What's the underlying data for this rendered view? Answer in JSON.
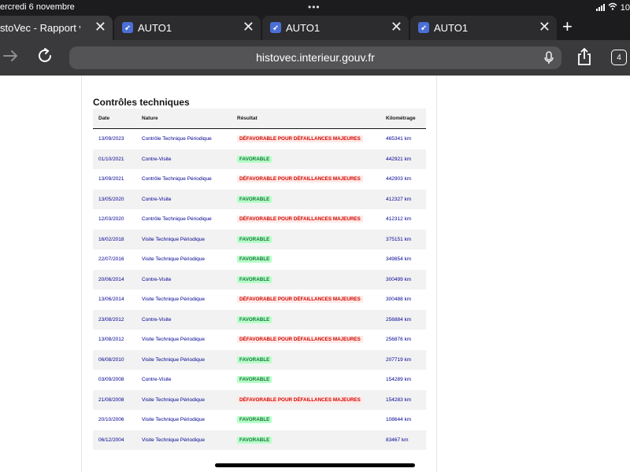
{
  "status": {
    "date": "ercredi 6 novembre",
    "dots": "•••",
    "time": "10"
  },
  "tabs": [
    {
      "label": "stoVec - Rapport vende",
      "active": true
    },
    {
      "label": "AUTO1",
      "active": false
    },
    {
      "label": "AUTO1",
      "active": false
    },
    {
      "label": "AUTO1",
      "active": false
    }
  ],
  "toolbar": {
    "url": "histovec.interieur.gouv.fr",
    "tab_count": "4"
  },
  "section": {
    "title": "Contrôles techniques"
  },
  "table": {
    "headers": [
      "Date",
      "Nature",
      "Résultat",
      "Kilométrage"
    ],
    "rows": [
      {
        "date": "13/09/2023",
        "nature": "Contrôle Technique Périodique",
        "result": "DÉFAVORABLE POUR DÉFAILLANCES MAJEURES",
        "km": "465341 km"
      },
      {
        "date": "01/10/2021",
        "nature": "Contre-Visite",
        "result": "FAVORABLE",
        "km": "442921 km"
      },
      {
        "date": "13/09/2021",
        "nature": "Contrôle Technique Périodique",
        "result": "DÉFAVORABLE POUR DÉFAILLANCES MAJEURES",
        "km": "442903 km"
      },
      {
        "date": "13/05/2020",
        "nature": "Contre-Visite",
        "result": "FAVORABLE",
        "km": "412327 km"
      },
      {
        "date": "12/03/2020",
        "nature": "Contrôle Technique Périodique",
        "result": "DÉFAVORABLE POUR DÉFAILLANCES MAJEURES",
        "km": "412312 km"
      },
      {
        "date": "16/02/2018",
        "nature": "Visite Technique Périodique",
        "result": "FAVORABLE",
        "km": "375151 km"
      },
      {
        "date": "22/07/2016",
        "nature": "Visite Technique Périodique",
        "result": "FAVORABLE",
        "km": "349854 km"
      },
      {
        "date": "20/06/2014",
        "nature": "Contre-Visite",
        "result": "FAVORABLE",
        "km": "300499 km"
      },
      {
        "date": "13/06/2014",
        "nature": "Visite Technique Périodique",
        "result": "DÉFAVORABLE POUR DÉFAILLANCES MAJEURES",
        "km": "300488 km"
      },
      {
        "date": "23/08/2012",
        "nature": "Contre-Visite",
        "result": "FAVORABLE",
        "km": "256884 km"
      },
      {
        "date": "13/08/2012",
        "nature": "Visite Technique Périodique",
        "result": "DÉFAVORABLE POUR DÉFAILLANCES MAJEURES",
        "km": "256876 km"
      },
      {
        "date": "06/08/2010",
        "nature": "Visite Technique Périodique",
        "result": "FAVORABLE",
        "km": "207719 km"
      },
      {
        "date": "03/09/2008",
        "nature": "Contre-Visite",
        "result": "FAVORABLE",
        "km": "154289 km"
      },
      {
        "date": "21/08/2008",
        "nature": "Visite Technique Périodique",
        "result": "DÉFAVORABLE POUR DÉFAILLANCES MAJEURES",
        "km": "154283 km"
      },
      {
        "date": "20/10/2006",
        "nature": "Visite Technique Périodique",
        "result": "FAVORABLE",
        "km": "108644 km"
      },
      {
        "date": "06/12/2004",
        "nature": "Visite Technique Périodique",
        "result": "FAVORABLE",
        "km": "83467 km"
      }
    ]
  },
  "colors": {
    "link_blue": "#000091",
    "favorable_bg": "#b8fec9",
    "favorable_text": "#18753c",
    "defavorable_bg": "#ffe9e6",
    "defavorable_text": "#ce0500"
  },
  "icons": {
    "back": "arrow-right-icon",
    "reload": "reload-icon",
    "mic": "microphone-icon",
    "share": "share-icon",
    "tab_close": "close-icon",
    "new_tab": "plus-icon",
    "favicon": "auto1-favicon-icon"
  }
}
